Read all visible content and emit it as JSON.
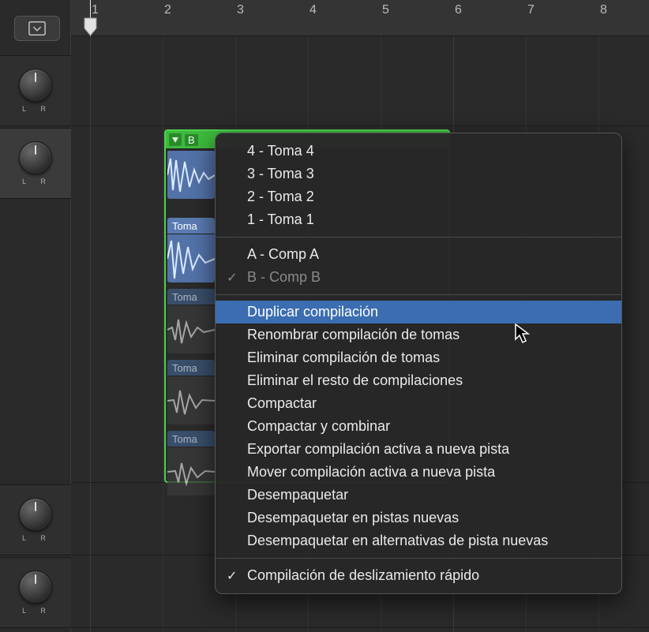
{
  "ruler": {
    "numbers": [
      "1",
      "2",
      "3",
      "4",
      "5",
      "6",
      "7",
      "8"
    ]
  },
  "tracks": {
    "lr_label": "L      R"
  },
  "take_folder": {
    "header_label": "B",
    "takes": [
      {
        "label": "Toma"
      },
      {
        "label": "Toma"
      },
      {
        "label": "Toma"
      },
      {
        "label": "Toma"
      }
    ]
  },
  "menu": {
    "sections": [
      [
        {
          "label": "4 - Toma 4"
        },
        {
          "label": "3 - Toma 3"
        },
        {
          "label": "2 - Toma 2"
        },
        {
          "label": "1 - Toma 1"
        }
      ],
      [
        {
          "label": "A - Comp A"
        },
        {
          "label": "B - Comp B",
          "checked": true,
          "disabled": true
        }
      ],
      [
        {
          "label": "Duplicar compilación",
          "highlighted": true
        },
        {
          "label": "Renombrar compilación de tomas"
        },
        {
          "label": "Eliminar compilación de tomas"
        },
        {
          "label": "Eliminar el resto de compilaciones"
        },
        {
          "label": "Compactar"
        },
        {
          "label": "Compactar y combinar"
        },
        {
          "label": "Exportar compilación activa a nueva pista"
        },
        {
          "label": "Mover compilación activa a nueva pista"
        },
        {
          "label": "Desempaquetar"
        },
        {
          "label": "Desempaquetar en pistas nuevas"
        },
        {
          "label": "Desempaquetar en alternativas de pista nuevas"
        }
      ],
      [
        {
          "label": "Compilación de deslizamiento rápido",
          "checked": true
        }
      ]
    ]
  }
}
